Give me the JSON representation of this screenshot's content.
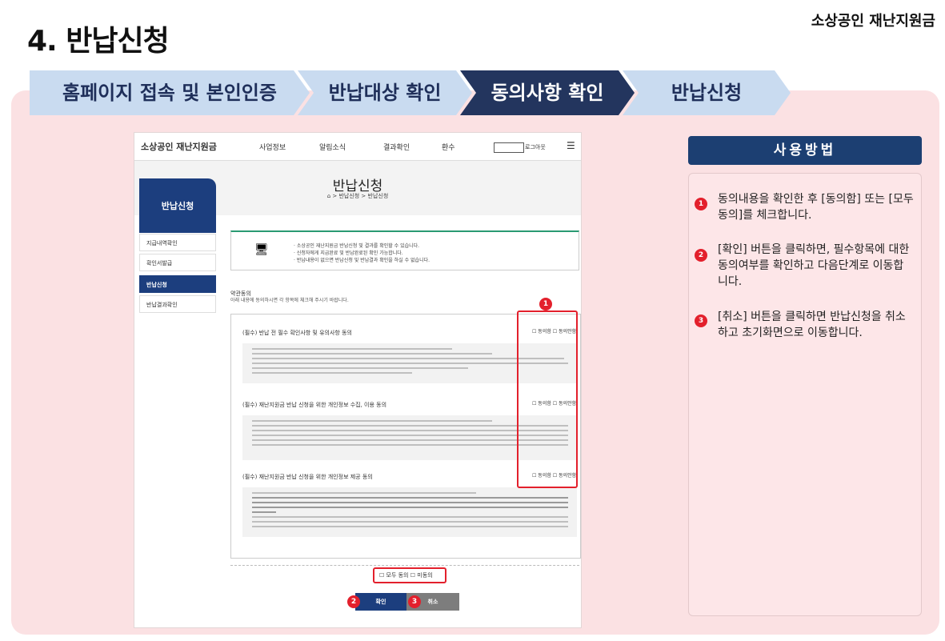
{
  "header": {
    "title": "4. 반납신청",
    "brand": "소상공인 재난지원금"
  },
  "steps": [
    {
      "label": "홈페이지 접속 및 본인인증",
      "active": false
    },
    {
      "label": "반납대상 확인",
      "active": false
    },
    {
      "label": "동의사항 확인",
      "active": true
    },
    {
      "label": "반납신청",
      "active": false
    }
  ],
  "colors": {
    "step_active": "#23355e",
    "step_inactive": "#c9dbf0",
    "panel_bg": "#fbe1e3",
    "accent_red": "#e3202c",
    "navy": "#1c3f72"
  },
  "shot": {
    "logo": "소상공인 재난지원금",
    "menu": [
      "사업정보",
      "알림소식",
      "결과확인",
      "환수"
    ],
    "search_label": "로그아웃",
    "page_title": "반납신청",
    "breadcrumb": "⌂ > 반납신청 > 반납신청",
    "lnb_title": "반납신청",
    "lnb_items": [
      "지급내역확인",
      "확인서발급",
      "반납신청",
      "반납결과확인"
    ],
    "notice_lines": [
      "· 소상공인 재난지원금 반납신청 및 결과를 확인할 수 있습니다.",
      "· 신청자에게 지급완료 및 반납완료된 확인 가능합니다.",
      "· 반납내용이 없으면 반납신청 및 반납결과 확인을 하실 수 없습니다."
    ],
    "agree_title": "약관동의",
    "agree_desc": "아래 내용에 동의하시면 각 항목에 체크해 주시기 바랍니다.",
    "sections": [
      {
        "title": "(필수) 반납 전 필수 확인사항 및 유의사항 동의"
      },
      {
        "title": "(필수) 재난지원금 반납 신청을 위한 개인정보 수집, 이용 동의"
      },
      {
        "title": "(필수) 재난지원금 반납 신청을 위한 개인정보 제공 동의"
      }
    ],
    "chk_agree": "동의함",
    "chk_disagree": "동의안함",
    "all_agree": "모두 동의",
    "all_disagree": "미동의",
    "btn_confirm": "확인",
    "btn_cancel": "취소"
  },
  "callouts": [
    "1",
    "2",
    "3"
  ],
  "how": {
    "title": "사용방법",
    "items": [
      {
        "num": "1",
        "text": "동의내용을 확인한 후 [동의함] 또는 [모두동의]를 체크합니다."
      },
      {
        "num": "2",
        "text": "[확인] 버튼을 클릭하면, 필수항목에 대한 동의여부를 확인하고 다음단계로 이동합니다."
      },
      {
        "num": "3",
        "text": "[취소] 버튼을 클릭하면 반납신청을 취소하고 초기화면으로 이동합니다."
      }
    ]
  }
}
